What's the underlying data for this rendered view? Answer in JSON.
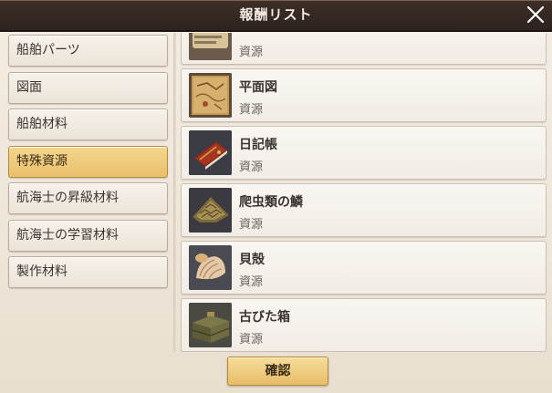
{
  "window": {
    "title": "報酬リスト",
    "close_icon": "close-icon"
  },
  "categories": [
    {
      "label": "船舶パーツ",
      "selected": false
    },
    {
      "label": "図面",
      "selected": false
    },
    {
      "label": "船舶材料",
      "selected": false
    },
    {
      "label": "特殊資源",
      "selected": true
    },
    {
      "label": "航海士の昇級材料",
      "selected": false
    },
    {
      "label": "航海士の学習材料",
      "selected": false
    },
    {
      "label": "製作材料",
      "selected": false
    }
  ],
  "items": [
    {
      "name": "",
      "category": "資源",
      "icon": "scroll-icon"
    },
    {
      "name": "平面図",
      "category": "資源",
      "icon": "map-icon"
    },
    {
      "name": "日記帳",
      "category": "資源",
      "icon": "diary-icon"
    },
    {
      "name": "爬虫類の鱗",
      "category": "資源",
      "icon": "reptile-scale-icon"
    },
    {
      "name": "貝殻",
      "category": "資源",
      "icon": "seashell-icon"
    },
    {
      "name": "古びた箱",
      "category": "資源",
      "icon": "old-box-icon"
    }
  ],
  "footer": {
    "confirm_label": "確認"
  },
  "colors": {
    "titlebar": "#2e231e",
    "panel": "#efe6da",
    "selected_tab": "#e9c06a",
    "confirm_button": "#e7bd67"
  }
}
